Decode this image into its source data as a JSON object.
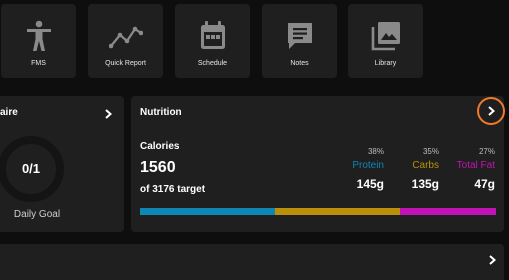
{
  "tiles": [
    {
      "label": "FMS",
      "icon": "person-icon"
    },
    {
      "label": "Quick Report",
      "icon": "trend-line-icon"
    },
    {
      "label": "Schedule",
      "icon": "calendar-icon"
    },
    {
      "label": "Notes",
      "icon": "notes-chat-icon"
    },
    {
      "label": "Library",
      "icon": "library-images-icon"
    }
  ],
  "questionnaire": {
    "title_partial": "aire",
    "count": "0/1",
    "caption": "Daily Goal"
  },
  "nutrition": {
    "title": "Nutrition",
    "calories_label": "Calories",
    "calories_value": "1560",
    "target_text": "of 3176 target",
    "macros": [
      {
        "name": "Protein",
        "percent": "38%",
        "grams": "145g",
        "color": "#0e87b5",
        "fraction": 0.38
      },
      {
        "name": "Carbs",
        "percent": "35%",
        "grams": "135g",
        "color": "#b8900a",
        "fraction": 0.35
      },
      {
        "name": "Total Fat",
        "percent": "27%",
        "grams": "47g",
        "color": "#c214b6",
        "fraction": 0.27
      }
    ],
    "highlight_color": "#f07a2a"
  }
}
